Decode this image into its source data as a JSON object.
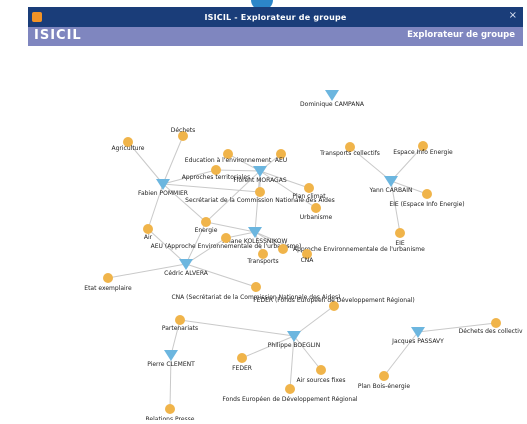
{
  "window": {
    "title": "ISICIL - Explorateur de groupe",
    "close_label": "×"
  },
  "header": {
    "logo": "ISICIL",
    "app_label": "Explorateur de groupe"
  },
  "nodes": [
    {
      "id": "dominique",
      "label": "Dominique CAMPANA",
      "kind": "person"
    },
    {
      "id": "fabien",
      "label": "Fabien POMMIER",
      "kind": "person"
    },
    {
      "id": "florent",
      "label": "Florent MORAGAS",
      "kind": "person"
    },
    {
      "id": "yann",
      "label": "Yann CARBAIN",
      "kind": "person"
    },
    {
      "id": "ariane",
      "label": "Ariane KOLESSNIKOW",
      "kind": "person"
    },
    {
      "id": "cedric",
      "label": "Cédric ALVERA",
      "kind": "person"
    },
    {
      "id": "philippe",
      "label": "Philippe BOEGLIN",
      "kind": "person"
    },
    {
      "id": "pierre",
      "label": "Pierre CLEMENT",
      "kind": "person"
    },
    {
      "id": "jacques",
      "label": "Jacques PASSAVY",
      "kind": "person"
    },
    {
      "id": "dechets",
      "label": "Déchets",
      "kind": "topic"
    },
    {
      "id": "agriculture",
      "label": "Agriculture",
      "kind": "topic"
    },
    {
      "id": "education",
      "label": "Education à l'environnement",
      "kind": "topic"
    },
    {
      "id": "aeu1",
      "label": "AEU",
      "kind": "topic"
    },
    {
      "id": "approches",
      "label": "Approches territoriales",
      "kind": "topic"
    },
    {
      "id": "plan_climat",
      "label": "Plan climat",
      "kind": "topic"
    },
    {
      "id": "transports_collectifs",
      "label": "Transports collectifs",
      "kind": "topic"
    },
    {
      "id": "espace_info",
      "label": "Espace Info Energie",
      "kind": "topic"
    },
    {
      "id": "secretariat",
      "label": "Secrétariat de la Commission Nationale des Aides",
      "kind": "topic"
    },
    {
      "id": "urbanisme",
      "label": "Urbanisme",
      "kind": "topic"
    },
    {
      "id": "eie",
      "label": "EIE (Espace Info Energie)",
      "kind": "topic"
    },
    {
      "id": "energie",
      "label": "Energie",
      "kind": "topic"
    },
    {
      "id": "air",
      "label": "Air",
      "kind": "topic"
    },
    {
      "id": "aeu_full",
      "label": "AEU (Approche Environnementale de l'urbanisme)",
      "kind": "topic"
    },
    {
      "id": "eie2",
      "label": "EIE",
      "kind": "topic"
    },
    {
      "id": "approche_env",
      "label": "Approche Environnementale de l'urbanisme",
      "kind": "topic"
    },
    {
      "id": "transports",
      "label": "Transports",
      "kind": "topic"
    },
    {
      "id": "cna",
      "label": "CNA",
      "kind": "topic"
    },
    {
      "id": "etat",
      "label": "Etat exemplaire",
      "kind": "topic"
    },
    {
      "id": "cna_full",
      "label": "CNA (Secrétariat de la Commission Nationale des Aides)",
      "kind": "topic"
    },
    {
      "id": "feder_full",
      "label": "FEDER (Fonds Européen de Développement Régional)",
      "kind": "topic"
    },
    {
      "id": "partenariats",
      "label": "Partenariats",
      "kind": "topic"
    },
    {
      "id": "dechets_coll",
      "label": "Déchets des collectivités",
      "kind": "topic"
    },
    {
      "id": "feder",
      "label": "FEDER",
      "kind": "topic"
    },
    {
      "id": "air_sources",
      "label": "Air sources fixes",
      "kind": "topic"
    },
    {
      "id": "plan_bois",
      "label": "Plan Bois-énergie",
      "kind": "topic"
    },
    {
      "id": "fonds",
      "label": "Fonds Européen de Développement Régional",
      "kind": "topic"
    },
    {
      "id": "relations",
      "label": "Relations Presse",
      "kind": "topic"
    }
  ],
  "edges": [
    [
      "fabien",
      "agriculture"
    ],
    [
      "fabien",
      "dechets"
    ],
    [
      "fabien",
      "approches"
    ],
    [
      "fabien",
      "energie"
    ],
    [
      "fabien",
      "air"
    ],
    [
      "fabien",
      "secretariat"
    ],
    [
      "florent",
      "education"
    ],
    [
      "florent",
      "aeu1"
    ],
    [
      "florent",
      "approches"
    ],
    [
      "florent",
      "plan_climat"
    ],
    [
      "florent",
      "urbanisme"
    ],
    [
      "florent",
      "secretariat"
    ],
    [
      "florent",
      "energie"
    ],
    [
      "florent",
      "ariane"
    ],
    [
      "yann",
      "transports_collectifs"
    ],
    [
      "yann",
      "espace_info"
    ],
    [
      "yann",
      "eie"
    ],
    [
      "yann",
      "eie2"
    ],
    [
      "ariane",
      "aeu_full"
    ],
    [
      "ariane",
      "approche_env"
    ],
    [
      "ariane",
      "transports"
    ],
    [
      "ariane",
      "cna"
    ],
    [
      "ariane",
      "energie"
    ],
    [
      "cedric",
      "air"
    ],
    [
      "cedric",
      "aeu_full"
    ],
    [
      "cedric",
      "etat"
    ],
    [
      "cedric",
      "cna_full"
    ],
    [
      "cedric",
      "energie"
    ],
    [
      "philippe",
      "feder_full"
    ],
    [
      "philippe",
      "partenariats"
    ],
    [
      "philippe",
      "feder"
    ],
    [
      "philippe",
      "air_sources"
    ],
    [
      "philippe",
      "fonds"
    ],
    [
      "pierre",
      "partenariats"
    ],
    [
      "pierre",
      "relations"
    ],
    [
      "jacques",
      "dechets_coll"
    ],
    [
      "jacques",
      "plan_bois"
    ]
  ],
  "colors": {
    "titlebar": "#1a3d79",
    "header": "#7f86bf",
    "person": "#6cb6df",
    "topic": "#f0b44a",
    "edge": "#c9c9c9"
  }
}
